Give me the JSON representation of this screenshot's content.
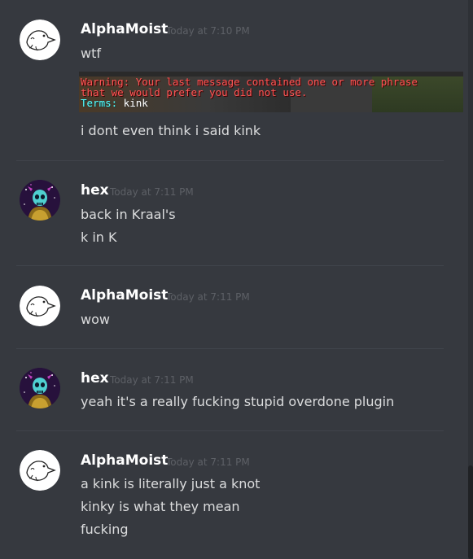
{
  "messages": [
    {
      "author": "AlphaMoist",
      "timestamp": "Today at 7:10 PM",
      "avatar_icon": "duck-avatar-icon",
      "lines": [
        "wtf"
      ],
      "attachment": {
        "warning_line1": "Warning: Your last message contained one or more phrase",
        "warning_line2": " that we would prefer you did not use.",
        "terms_label": "Terms:",
        "terms_value": " kink"
      },
      "after_lines": [
        "i dont even think i said kink"
      ]
    },
    {
      "author": "hex",
      "timestamp": "Today at 7:11 PM",
      "avatar_icon": "skull-avatar-icon",
      "lines": [
        "back in Kraal's",
        "k in K"
      ]
    },
    {
      "author": "AlphaMoist",
      "timestamp": "Today at 7:11 PM",
      "avatar_icon": "duck-avatar-icon",
      "lines": [
        "wow"
      ]
    },
    {
      "author": "hex",
      "timestamp": "Today at 7:11 PM",
      "avatar_icon": "skull-avatar-icon",
      "lines": [
        "yeah it's a really fucking stupid overdone plugin"
      ]
    },
    {
      "author": "AlphaMoist",
      "timestamp": "Today at 7:11 PM",
      "avatar_icon": "duck-avatar-icon",
      "lines": [
        "a kink is literally just a  knot",
        "kinky is what they mean",
        "fucking"
      ]
    }
  ],
  "colors": {
    "background": "#36393f",
    "username": "#ffffff",
    "message_text": "#dcddde",
    "timestamp": "#5d6066",
    "divider": "#40444b",
    "warning_red": "#ff5555",
    "terms_aqua": "#55ffff"
  }
}
